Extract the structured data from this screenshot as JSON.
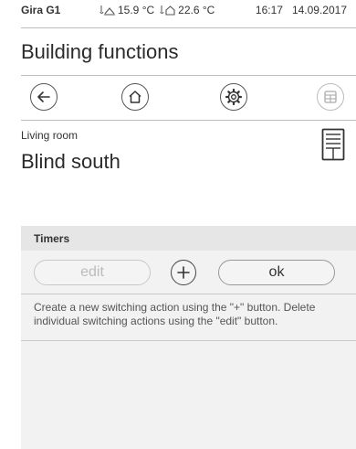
{
  "status": {
    "brand": "Gira G1",
    "temp_outdoor": "15.9 °C",
    "temp_indoor": "22.6 °C",
    "time": "16:17",
    "date": "14.09.2017"
  },
  "page_title": "Building functions",
  "nav": {
    "back_icon": "arrow-left-icon",
    "home_icon": "home-icon",
    "settings_icon": "gear-icon",
    "grid_icon": "grid-icon"
  },
  "room": "Living room",
  "device_title": "Blind south",
  "timers": {
    "section_label": "Timers",
    "edit_label": "edit",
    "ok_label": "ok",
    "hint": "Create a new switching action using the \"+\" button. Delete individual switching actions using the \"edit\" button."
  }
}
